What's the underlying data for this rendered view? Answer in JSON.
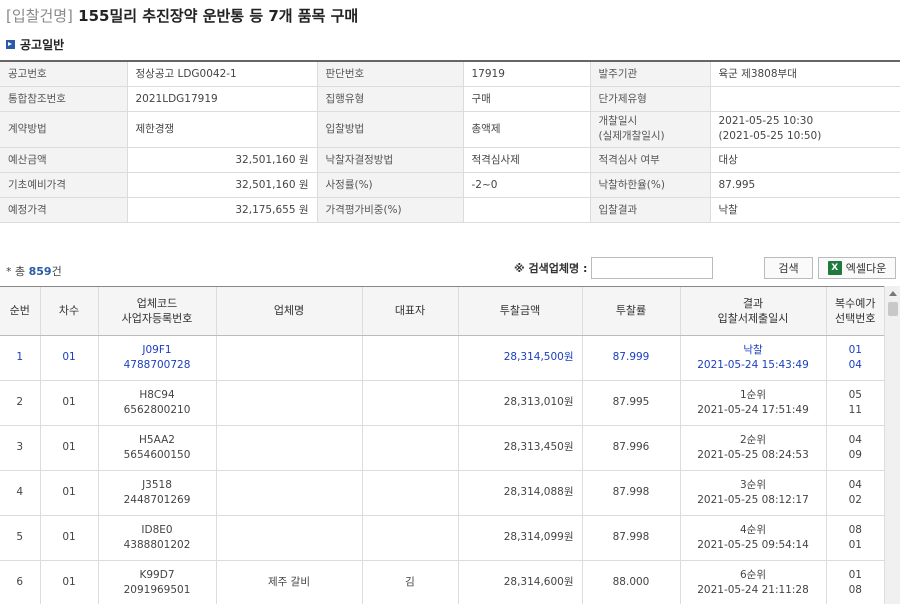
{
  "title": {
    "bracket": "[입찰건명]",
    "text": "155밀리 추진장약 운반통 등 7개 품목 구매"
  },
  "section": {
    "label": "공고일반"
  },
  "info_rows": [
    [
      {
        "label": "공고번호",
        "value": "정상공고 LDG0042-1"
      },
      {
        "label": "판단번호",
        "value": "17919"
      },
      {
        "label": "발주기관",
        "value": "육군 제3808부대"
      }
    ],
    [
      {
        "label": "통합참조번호",
        "value": "2021LDG17919"
      },
      {
        "label": "집행유형",
        "value": "구매"
      },
      {
        "label": "단가제유형",
        "value": ""
      }
    ],
    [
      {
        "label": "계약방법",
        "value": "제한경쟁"
      },
      {
        "label": "입찰방법",
        "value": "총액제"
      },
      {
        "label": "개찰일시\n(실제개찰일시)",
        "value": "2021-05-25 10:30\n(2021-05-25 10:50)"
      }
    ],
    [
      {
        "label": "예산금액",
        "value": "32,501,160 원"
      },
      {
        "label": "낙찰자결정방법",
        "value": "적격심사제"
      },
      {
        "label": "적격심사 여부",
        "value": "대상"
      }
    ],
    [
      {
        "label": "기초예비가격",
        "value": "32,501,160 원"
      },
      {
        "label": "사정률(%)",
        "value": "-2~0"
      },
      {
        "label": "낙찰하한율(%)",
        "value": "87.995"
      }
    ],
    [
      {
        "label": "예정가격",
        "value": "32,175,655 원"
      },
      {
        "label": "가격평가비중(%)",
        "value": ""
      },
      {
        "label": "입찰결과",
        "value": "낙찰"
      }
    ]
  ],
  "summary": {
    "prefix": "* 총",
    "count": "859",
    "suffix": "건"
  },
  "search": {
    "label": "※ 검색업체명 :",
    "value": "",
    "placeholder": "",
    "button": "검색",
    "excel_icon": "X",
    "excel_button": "엑셀다운"
  },
  "grid": {
    "headers": [
      "순번",
      "차수",
      "업체코드\n사업자등록번호",
      "업체명",
      "대표자",
      "투찰금액",
      "투찰률",
      "결과\n입찰서제출일시",
      "복수예가\n선택번호"
    ],
    "rows": [
      {
        "seq": "1",
        "round": "01",
        "code": "J09F1",
        "bizno": "4788700728",
        "company": "",
        "rep": "",
        "amount": "28,314,500원",
        "rate": "87.999",
        "result": "낙찰",
        "submitted": "2021-05-24 15:43:49",
        "pick1": "01",
        "pick2": "04"
      },
      {
        "seq": "2",
        "round": "01",
        "code": "H8C94",
        "bizno": "6562800210",
        "company": "",
        "rep": "",
        "amount": "28,313,010원",
        "rate": "87.995",
        "result": "1순위",
        "submitted": "2021-05-24 17:51:49",
        "pick1": "05",
        "pick2": "11"
      },
      {
        "seq": "3",
        "round": "01",
        "code": "H5AA2",
        "bizno": "5654600150",
        "company": "",
        "rep": "",
        "amount": "28,313,450원",
        "rate": "87.996",
        "result": "2순위",
        "submitted": "2021-05-25 08:24:53",
        "pick1": "04",
        "pick2": "09"
      },
      {
        "seq": "4",
        "round": "01",
        "code": "J3518",
        "bizno": "2448701269",
        "company": "",
        "rep": "",
        "amount": "28,314,088원",
        "rate": "87.998",
        "result": "3순위",
        "submitted": "2021-05-25 08:12:17",
        "pick1": "04",
        "pick2": "02"
      },
      {
        "seq": "5",
        "round": "01",
        "code": "ID8E0",
        "bizno": "4388801202",
        "company": "",
        "rep": "",
        "amount": "28,314,099원",
        "rate": "87.998",
        "result": "4순위",
        "submitted": "2021-05-25 09:54:14",
        "pick1": "08",
        "pick2": "01"
      },
      {
        "seq": "6",
        "round": "01",
        "code": "K99D7",
        "bizno": "2091969501",
        "company": "제주 갈비",
        "rep": "김",
        "amount": "28,314,600원",
        "rate": "88.000",
        "result": "6순위",
        "submitted": "2021-05-24 21:11:28",
        "pick1": "01",
        "pick2": "08"
      }
    ]
  }
}
